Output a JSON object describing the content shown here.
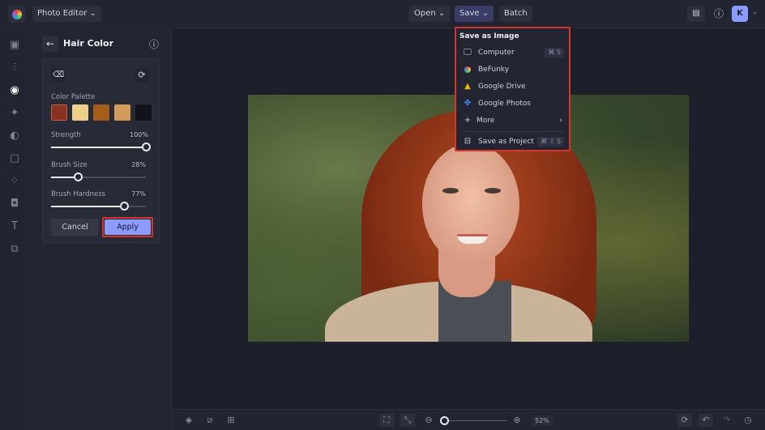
{
  "topbar": {
    "app_menu": "Photo Editor",
    "open": "Open",
    "save": "Save",
    "batch": "Batch",
    "avatar_initial": "K"
  },
  "panel": {
    "title": "Hair Color",
    "palette_label": "Color Palette",
    "palette": [
      "#8a3222",
      "#ecd08a",
      "#a55e1a",
      "#d49a5a",
      "#11121a"
    ],
    "sliders": [
      {
        "label": "Strength",
        "value": "100%",
        "fraction": 1.0
      },
      {
        "label": "Brush Size",
        "value": "28%",
        "fraction": 0.28
      },
      {
        "label": "Brush Hardness",
        "value": "77%",
        "fraction": 0.77
      }
    ],
    "cancel": "Cancel",
    "apply": "Apply"
  },
  "save_menu": {
    "heading": "Save as Image",
    "items": [
      {
        "label": "Computer",
        "icon": "monitor-icon",
        "shortcut": "⌘ S"
      },
      {
        "label": "BeFunky",
        "icon": "befunky-icon"
      },
      {
        "label": "Google Drive",
        "icon": "google-drive-icon"
      },
      {
        "label": "Google Photos",
        "icon": "google-photos-icon"
      },
      {
        "label": "More",
        "icon": "plus-icon"
      },
      {
        "label": "Save as Project",
        "icon": "briefcase-icon",
        "shortcut": "⌘ ⇧ S"
      }
    ]
  },
  "bottom": {
    "zoom": "52%",
    "zoom_fraction": 0.05
  },
  "colors": {
    "accent": "#8c9bff",
    "highlight": "#d8352a"
  }
}
